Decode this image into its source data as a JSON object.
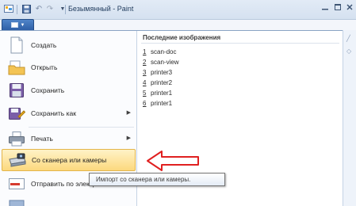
{
  "window": {
    "title": "Безымянный - Paint",
    "controls": [
      "minimize",
      "maximize",
      "close"
    ]
  },
  "quick_access": {
    "icons": [
      "paint-app-icon",
      "save-icon",
      "undo-icon",
      "redo-icon",
      "customize-arrow-icon"
    ]
  },
  "app_menu": {
    "button_icon": "menu-icon",
    "items": [
      {
        "id": "new",
        "label": "Создать",
        "icon": "new-document-icon",
        "has_submenu": false
      },
      {
        "id": "open",
        "label": "Открыть",
        "icon": "open-folder-icon",
        "has_submenu": false
      },
      {
        "id": "save",
        "label": "Сохранить",
        "icon": "save-disk-icon",
        "has_submenu": false
      },
      {
        "id": "save_as",
        "label": "Сохранить как",
        "icon": "save-as-icon",
        "has_submenu": true
      },
      {
        "id": "print",
        "label": "Печать",
        "icon": "printer-icon",
        "has_submenu": true
      },
      {
        "id": "scanner",
        "label": "Со сканера или камеры",
        "icon": "scanner-icon",
        "has_submenu": false,
        "highlighted": true
      },
      {
        "id": "email",
        "label": "Отправить по электро",
        "icon": "email-icon",
        "has_submenu": false
      }
    ]
  },
  "recent": {
    "title": "Последние изображения",
    "items": [
      {
        "num": "1",
        "name": "scan-doc"
      },
      {
        "num": "2",
        "name": "scan-view"
      },
      {
        "num": "3",
        "name": "printer3"
      },
      {
        "num": "4",
        "name": "printer2"
      },
      {
        "num": "5",
        "name": "printer1"
      },
      {
        "num": "6",
        "name": "printer1"
      }
    ]
  },
  "tooltip": {
    "text": "Импорт со сканера или камеры."
  },
  "colors": {
    "highlight": "#fcd97e",
    "annotation_arrow": "#e02020",
    "app_button": "#2e5fa6"
  }
}
